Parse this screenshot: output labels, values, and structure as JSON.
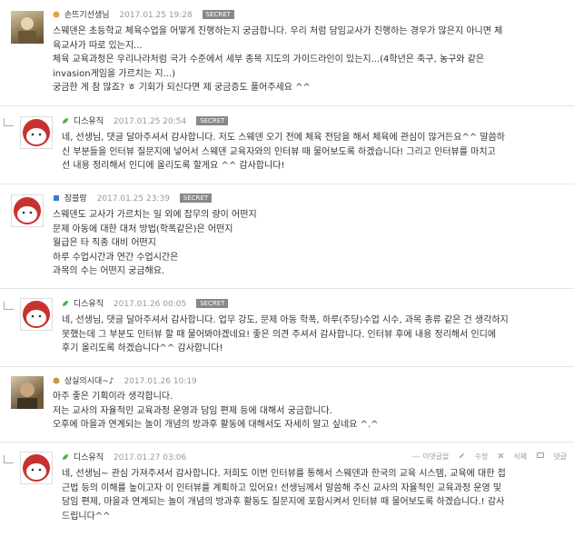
{
  "comments": [
    {
      "nick": "손뜨기선생님",
      "date": "2017.01.25 19:28",
      "badge": "SECRET",
      "avatar": "user-photo",
      "text": "스웨덴은 초등학교 체육수업을 어떻게 진행하는지 궁금합니다. 우리 처럼 담임교사가 진행하는 경우가 많은지 아니면 체\n육교사가 따로 있는지...\n체육 교육과정은 우리나라처럼 국가 수준에서 세부 종목 지도의 가이드라인이 있는지...(4학년은 축구, 농구와 같은\ninvasion게임을 가르치는 지...)\n궁금한 게 참 많죠? ㅎ 기회가 되신다면 제 궁금증도 풀어주세요 ^^"
    },
    {
      "nick": "디스유직",
      "date": "2017.01.25 20:54",
      "badge": "SECRET",
      "avatar": "default-character",
      "text": "네, 선생님, 댓글 달아주셔서 감사합니다. 저도 스웨덴 오기 전에 체육 전담을 해서 체육에 관심이 많거든요^^ 말씀하\n신 부분들을 인터뷰 질문지에 넣어서 스웨덴 교육자와의 인터뷰 때 물어보도록 하겠습니다! 그리고 인터뷰를 마치고\n선 내용 정리해서 인디에 올리도록 할게요 ^^ 감사합니다!"
    },
    {
      "nick": "잠블랑",
      "date": "2017.01.25 23:39",
      "badge": "SECRET",
      "avatar": "default-character",
      "text": "스웨덴도 교사가 가르치는 일 외에 잡무의 량이 어떤지\n문제 아동에 대한 대처 방법(학폭같은)은 어떤지\n월급은 타 직종 대비 어떤지\n하루 수업시간과 연간 수업시간은\n과목의 수는 어떤지 궁금해요."
    },
    {
      "nick": "디스유직",
      "date": "2017.01.26 00:05",
      "badge": "SECRET",
      "avatar": "default-character",
      "text": "네, 선생님, 댓글 달아주셔서 감사합니다. 업무 강도, 문제 아동 학폭, 하루(주당)수업 시수, 과목 종류 같은 건 생각하지\n못했는데 그 부분도 인터뷰 할 때 물어봐야겠네요! 좋은 의견 주셔서 감사합니다. 인터뷰 후에 내용 정리해서 인디에\n후기 올리도록 하겠습니다^^ 감사합니다!"
    },
    {
      "nick": "상실의시대~♪",
      "date": "2017.01.26 10:19",
      "badge": "",
      "avatar": "user-photo",
      "text": "아주 좋은 기획이라 생각합니다.\n저는 교사의 자율적인 교육과정 운영과 담임 편제 등에 대해서 궁금합니다.\n오후에 마을과 연계되는 놀이 개념의 방과후 활동에 대해서도 자세히 알고 싶네요 ^.^"
    },
    {
      "nick": "디스유직",
      "date": "2017.01.27 03:06",
      "badge": "",
      "avatar": "default-character",
      "actions": [
        "--- 이댓글을",
        "수정",
        "삭제",
        "댓글"
      ],
      "text": "네, 선생님~ 관심 가져주셔서 감사합니다. 저희도 이번 인터뷰를 통해서 스웨덴과 한국의 교육 시스템, 교육에 대한 접\n근법 등의 이해를 높이고자 이 인터뷰를 계획하고 있어요! 선생님께서 말씀해 주신 교사의 자율적인 교육과정 운영 및\n담임 편제, 마을과 연계되는 놀이 개념의 방과후 활동도 질문지에 포함시켜서 인터뷰 때 물어보도록 하겠습니다.! 감사\n드립니다^^"
    }
  ],
  "colors": {
    "badge": "#888888",
    "avatar_red": "#c8312f",
    "leaf": "#4caf50"
  }
}
